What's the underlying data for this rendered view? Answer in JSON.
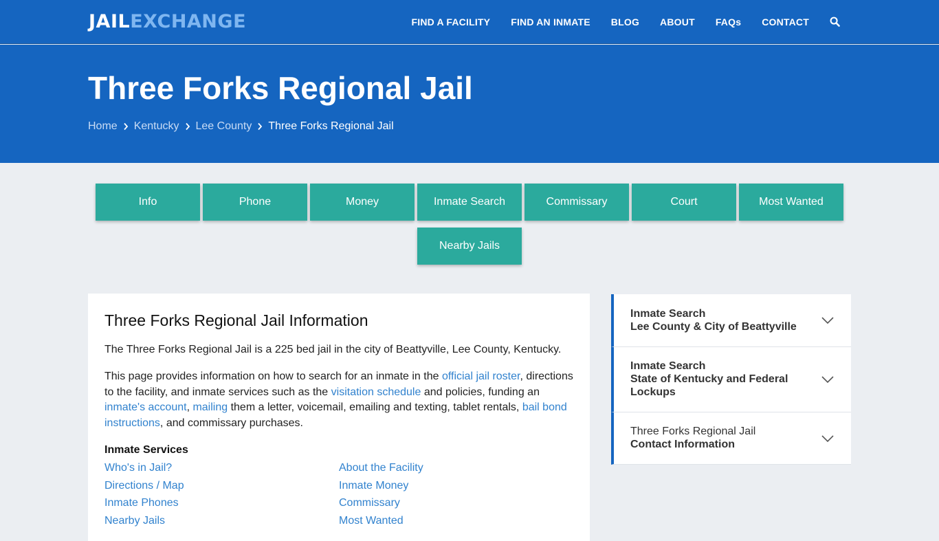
{
  "logo": {
    "part1": "JAIL",
    "part2": "EXCHANGE"
  },
  "nav": {
    "items": [
      "FIND A FACILITY",
      "FIND AN INMATE",
      "BLOG",
      "ABOUT",
      "FAQs",
      "CONTACT"
    ],
    "search_icon": "search-icon"
  },
  "hero": {
    "title": "Three Forks Regional Jail",
    "breadcrumb": [
      "Home",
      "Kentucky",
      "Lee County",
      "Three Forks Regional Jail"
    ]
  },
  "tabs": [
    "Info",
    "Phone",
    "Money",
    "Inmate Search",
    "Commissary",
    "Court",
    "Most Wanted",
    "Nearby Jails"
  ],
  "main": {
    "heading": "Three Forks Regional Jail Information",
    "intro": "The Three Forks Regional Jail is a 225 bed jail in the city of Beattyville, Lee County, Kentucky.",
    "para2": {
      "t1": "This page provides information on how to search for an inmate in the ",
      "l1": "official jail roster",
      "t2": ", directions to the facility, and inmate services such as the ",
      "l2": "visitation schedule",
      "t3": " and policies, funding an ",
      "l3": "inmate's account",
      "t4": ", ",
      "l4": "mailing",
      "t5": " them a letter, voicemail, emailing and texting, tablet rentals, ",
      "l5": "bail bond instructions",
      "t6": ", and commissary purchases."
    },
    "services_title": "Inmate Services",
    "services_left": [
      "Who's in Jail?",
      "Directions / Map",
      "Inmate Phones",
      "Nearby Jails"
    ],
    "services_right": [
      "About the Facility",
      "Inmate Money",
      "Commissary",
      "Most Wanted"
    ]
  },
  "sidebar": [
    {
      "line1": "Inmate Search",
      "line2": "Lee County & City of Beattyville",
      "line1_bold": true
    },
    {
      "line1": "Inmate Search",
      "line2": "State of Kentucky and Federal",
      "line3": "Lockups",
      "line1_bold": true
    },
    {
      "line1": "Three Forks Regional Jail",
      "line2": "Contact Information",
      "line1_bold": false
    }
  ],
  "colors": {
    "brand": "#1565c0",
    "tab": "#2baa9d",
    "link": "#3182ce",
    "logo_accent": "#7fb6f0"
  }
}
